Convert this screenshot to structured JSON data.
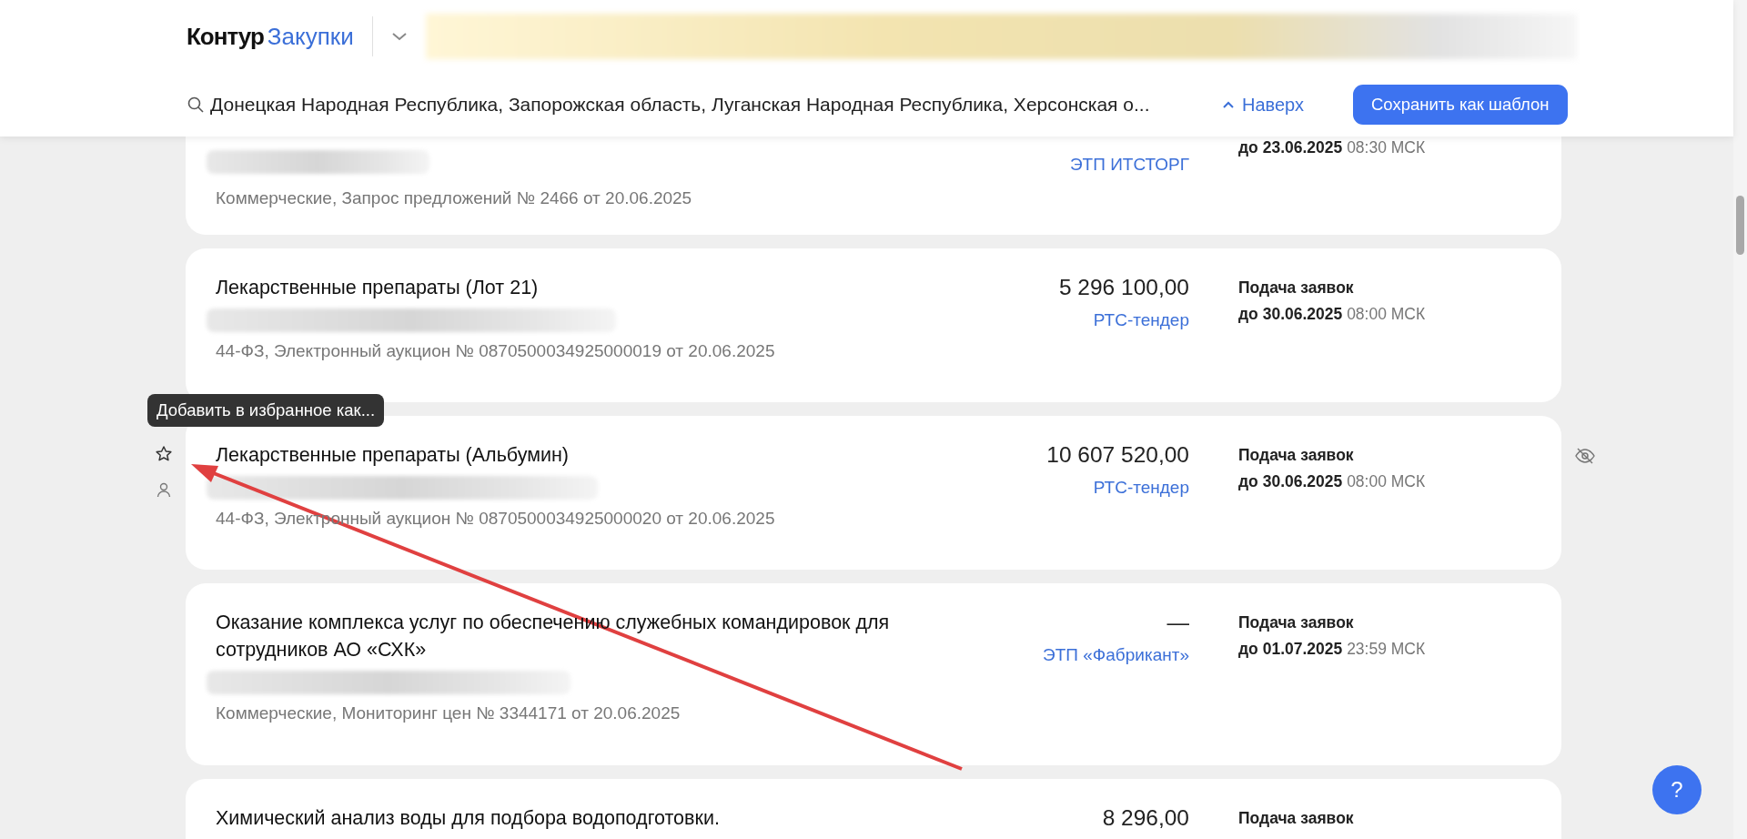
{
  "header": {
    "logo": {
      "brand": "Контур",
      "product": "Закупки"
    },
    "search": {
      "value": "Донецкая Народная Республика, Запорожская область, Луганская Народная Республика, Херсонская о..."
    },
    "up_link": "Наверх",
    "save_button": "Сохранить как шаблон"
  },
  "tooltip": "Добавить в избранное как...",
  "cards": [
    {
      "platform": "ЭТП ИТСТОРГ",
      "deadline_date": "до 23.06.2025",
      "deadline_time": "08:30 МСК",
      "subtitle": "Коммерческие, Запрос предложений № 2466 от 20.06.2025",
      "hovered": false
    },
    {
      "title": "Лекарственные препараты (Лот 21)",
      "price": "5 296 100,00",
      "platform": "РТС-тендер",
      "deadline_label": "Подача заявок",
      "deadline_date": "до 30.06.2025",
      "deadline_time": "08:00 МСК",
      "subtitle": "44-ФЗ, Электронный аукцион № 0870500034925000019 от 20.06.2025",
      "hovered": false
    },
    {
      "title": "Лекарственные препараты (Альбумин)",
      "price": "10 607 520,00",
      "platform": "РТС-тендер",
      "deadline_label": "Подача заявок",
      "deadline_date": "до 30.06.2025",
      "deadline_time": "08:00 МСК",
      "subtitle": "44-ФЗ, Электронный аукцион № 0870500034925000020 от 20.06.2025",
      "hovered": true
    },
    {
      "title": "Оказание комплекса услуг по обеспечению служебных командировок для сотрудников АО «СХК»",
      "price": "—",
      "platform": "ЭТП «Фабрикант»",
      "deadline_label": "Подача заявок",
      "deadline_date": "до 01.07.2025",
      "deadline_time": "23:59 МСК",
      "subtitle": "Коммерческие, Мониторинг цен № 3344171 от 20.06.2025",
      "hovered": false
    },
    {
      "title": "Химический анализ воды для подбора водоподготовки.",
      "price": "8 296,00",
      "deadline_label": "Подача заявок",
      "hovered": false
    }
  ],
  "help_button": "?"
}
